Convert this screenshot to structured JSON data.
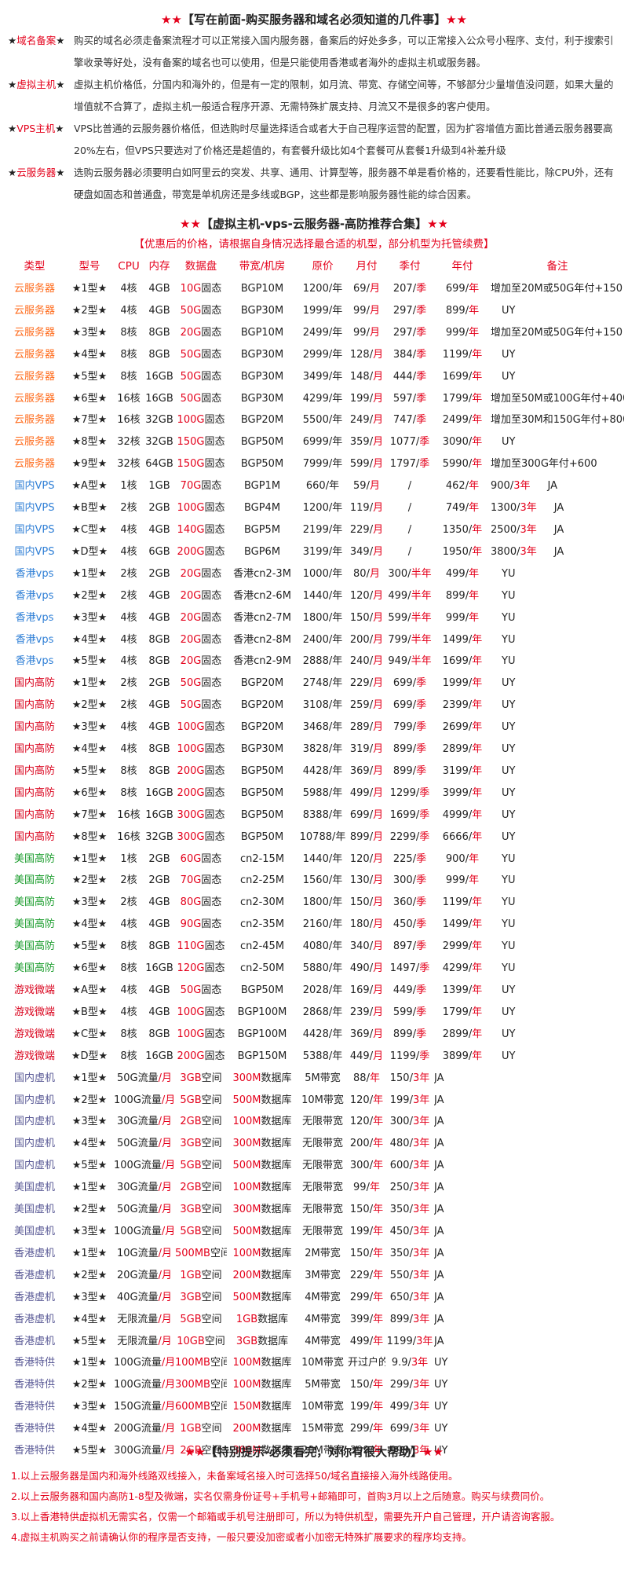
{
  "colors": {
    "accent_red": "#e4001b",
    "orange": "#ff6a1a",
    "blue": "#2f7fd6",
    "red": "#d9001b",
    "green": "#1a9c2c",
    "gray": "#5a5a96"
  },
  "section1": {
    "stars": "★★",
    "title": "【写在前面-购买服务器和域名必须知道的几件事】",
    "items": [
      {
        "tag": "域名备案",
        "text": "购买的域名必须走备案流程才可以正常接入国内服务器，备案后的好处多多，可以正常接入公众号小程序、支付，利于搜索引擎收录等好处，没有备案的域名也可以使用，但是只能使用香港或者海外的虚拟主机或服务器。"
      },
      {
        "tag": "虚拟主机",
        "text": "虚拟主机价格低，分国内和海外的，但是有一定的限制，如月流、带宽、存储空间等，不够部分少量增值没问题，如果大量的增值就不合算了，虚拟主机一般适合程序开源、无需特殊扩展支持、月流又不是很多的客户使用。"
      },
      {
        "tag": "VPS主机",
        "text": "VPS比普通的云服务器价格低，但选购时尽量选择适合或者大于自己程序运营的配置，因为扩容增值方面比普通云服务器要高20%左右，但VPS只要选对了价格还是超值的，有套餐升级比如4个套餐可从套餐1升级到4补差升级"
      },
      {
        "tag": "云服务器",
        "text": "选购云服务器必须要明白如阿里云的突发、共享、通用、计算型等，服务器不单是看价格的，还要看性能比，除CPU外，还有硬盘如固态和普通盘，带宽是单机房还是多线或BGP，这些都是影响服务器性能的综合因素。"
      }
    ]
  },
  "section2": {
    "stars": "★★",
    "title": "【虚拟主机-vps-云服务器-高防推荐合集】",
    "subtitle": "【优惠后的价格，请根据自身情况选择最合适的机型，部分机型为托管续费】",
    "headers": [
      "类型",
      "型号",
      "CPU",
      "内存",
      "数据盘",
      "带宽/机房",
      "原价",
      "月付",
      "季付",
      "年付",
      "备注"
    ],
    "rows_a": [
      {
        "cat": "云服务器",
        "model": "★1型★",
        "cpu": "4",
        "cpu_u": "核",
        "mem": "4GB",
        "disk": "10G",
        "disk_u": "固态",
        "bw": "BGP10M",
        "orig": "1200/年",
        "m": "69/",
        "q": "207/",
        "y": "699/",
        "note": "增加至20M或50G年付+150"
      },
      {
        "cat": "云服务器",
        "model": "★2型★",
        "cpu": "4",
        "cpu_u": "核",
        "mem": "4GB",
        "disk": "50G",
        "disk_u": "固态",
        "bw": "BGP30M",
        "orig": "1999/年",
        "m": "99/",
        "q": "297/",
        "y": "899/",
        "note": "UY"
      },
      {
        "cat": "云服务器",
        "model": "★3型★",
        "cpu": "8",
        "cpu_u": "核",
        "mem": "8GB",
        "disk": "20G",
        "disk_u": "固态",
        "bw": "BGP10M",
        "orig": "2499/年",
        "m": "99/",
        "q": "297/",
        "y": "999/",
        "note": "增加至20M或50G年付+150"
      },
      {
        "cat": "云服务器",
        "model": "★4型★",
        "cpu": "8",
        "cpu_u": "核",
        "mem": "8GB",
        "disk": "50G",
        "disk_u": "固态",
        "bw": "BGP30M",
        "orig": "2999/年",
        "m": "128/",
        "q": "384/",
        "y": "1199/",
        "note": "UY"
      },
      {
        "cat": "云服务器",
        "model": "★5型★",
        "cpu": "8",
        "cpu_u": "核",
        "mem": "16GB",
        "disk": "50G",
        "disk_u": "固态",
        "bw": "BGP30M",
        "orig": "3499/年",
        "m": "148/",
        "q": "444/",
        "y": "1699/",
        "note": "UY"
      },
      {
        "cat": "云服务器",
        "model": "★6型★",
        "cpu": "16",
        "cpu_u": "核",
        "mem": "16GB",
        "disk": "50G",
        "disk_u": "固态",
        "bw": "BGP30M",
        "orig": "4299/年",
        "m": "199/",
        "q": "597/",
        "y": "1799/",
        "note": "增加至50M或100G年付+400"
      },
      {
        "cat": "云服务器",
        "model": "★7型★",
        "cpu": "16",
        "cpu_u": "核",
        "mem": "32GB",
        "disk": "100G",
        "disk_u": "固态",
        "bw": "BGP20M",
        "orig": "5500/年",
        "m": "249/",
        "q": "747/",
        "y": "2499/",
        "note": "增加至30M和150G年付+800"
      },
      {
        "cat": "云服务器",
        "model": "★8型★",
        "cpu": "32",
        "cpu_u": "核",
        "mem": "32GB",
        "disk": "150G",
        "disk_u": "固态",
        "bw": "BGP50M",
        "orig": "6999/年",
        "m": "359/",
        "q": "1077/",
        "y": "3090/",
        "note": "UY"
      },
      {
        "cat": "云服务器",
        "model": "★9型★",
        "cpu": "32",
        "cpu_u": "核",
        "mem": "64GB",
        "disk": "150G",
        "disk_u": "固态",
        "bw": "BGP50M",
        "orig": "7999/年",
        "m": "599/",
        "q": "1797/",
        "y": "5990/",
        "note": "增加至300G年付+600"
      }
    ],
    "rows_b": [
      {
        "cat": "国内VPS",
        "model": "★A型★",
        "cpu": "1",
        "cpu_u": "核",
        "mem": "1GB",
        "disk": "70G",
        "disk_u": "固态",
        "bw": "BGP1M",
        "orig": "660/年",
        "m": "59/",
        "y": "462/",
        "ext": "900/",
        "note": "JA"
      },
      {
        "cat": "国内VPS",
        "model": "★B型★",
        "cpu": "2",
        "cpu_u": "核",
        "mem": "2GB",
        "disk": "100G",
        "disk_u": "固态",
        "bw": "BGP4M",
        "orig": "1200/年",
        "m": "119/",
        "y": "749/",
        "ext": "1300/",
        "note": "JA"
      },
      {
        "cat": "国内VPS",
        "model": "★C型★",
        "cpu": "4",
        "cpu_u": "核",
        "mem": "4GB",
        "disk": "140G",
        "disk_u": "固态",
        "bw": "BGP5M",
        "orig": "2199/年",
        "m": "229/",
        "y": "1350/",
        "ext": "2500/",
        "note": "JA"
      },
      {
        "cat": "国内VPS",
        "model": "★D型★",
        "cpu": "4",
        "cpu_u": "核",
        "mem": "6GB",
        "disk": "200G",
        "disk_u": "固态",
        "bw": "BGP6M",
        "orig": "3199/年",
        "m": "349/",
        "y": "1950/",
        "ext": "3800/",
        "note": "JA"
      }
    ],
    "rows_c": [
      {
        "cat": "香港vps",
        "model": "★1型★",
        "cpu": "2",
        "cpu_u": "核",
        "mem": "2GB",
        "disk": "20G",
        "disk_u": "固态",
        "bw": "香港cn2-3M",
        "orig": "1000/年",
        "m": "80/",
        "q": "300/",
        "y": "499/",
        "note": "YU"
      },
      {
        "cat": "香港vps",
        "model": "★2型★",
        "cpu": "2",
        "cpu_u": "核",
        "mem": "4GB",
        "disk": "20G",
        "disk_u": "固态",
        "bw": "香港cn2-6M",
        "orig": "1440/年",
        "m": "120/",
        "q": "499/",
        "y": "899/",
        "note": "YU"
      },
      {
        "cat": "香港vps",
        "model": "★3型★",
        "cpu": "4",
        "cpu_u": "核",
        "mem": "4GB",
        "disk": "20G",
        "disk_u": "固态",
        "bw": "香港cn2-7M",
        "orig": "1800/年",
        "m": "150/",
        "q": "599/",
        "y": "999/",
        "note": "YU"
      },
      {
        "cat": "香港vps",
        "model": "★4型★",
        "cpu": "4",
        "cpu_u": "核",
        "mem": "8GB",
        "disk": "20G",
        "disk_u": "固态",
        "bw": "香港cn2-8M",
        "orig": "2400/年",
        "m": "200/",
        "q": "799/",
        "y": "1499/",
        "note": "YU"
      },
      {
        "cat": "香港vps",
        "model": "★5型★",
        "cpu": "4",
        "cpu_u": "核",
        "mem": "8GB",
        "disk": "20G",
        "disk_u": "固态",
        "bw": "香港cn2-9M",
        "orig": "2888/年",
        "m": "240/",
        "q": "949/",
        "y": "1699/",
        "note": "YU"
      }
    ],
    "rows_d": [
      {
        "cat": "国内高防",
        "model": "★1型★",
        "cpu": "2",
        "cpu_u": "核",
        "mem": "2GB",
        "disk": "50G",
        "disk_u": "固态",
        "bw": "BGP20M",
        "orig": "2748/年",
        "m": "229/",
        "q": "699/",
        "y": "1999/",
        "note": "UY"
      },
      {
        "cat": "国内高防",
        "model": "★2型★",
        "cpu": "2",
        "cpu_u": "核",
        "mem": "4GB",
        "disk": "50G",
        "disk_u": "固态",
        "bw": "BGP20M",
        "orig": "3108/年",
        "m": "259/",
        "q": "699/",
        "y": "2399/",
        "note": "UY"
      },
      {
        "cat": "国内高防",
        "model": "★3型★",
        "cpu": "4",
        "cpu_u": "核",
        "mem": "4GB",
        "disk": "100G",
        "disk_u": "固态",
        "bw": "BGP20M",
        "orig": "3468/年",
        "m": "289/",
        "q": "799/",
        "y": "2699/",
        "note": "UY"
      },
      {
        "cat": "国内高防",
        "model": "★4型★",
        "cpu": "4",
        "cpu_u": "核",
        "mem": "8GB",
        "disk": "100G",
        "disk_u": "固态",
        "bw": "BGP30M",
        "orig": "3828/年",
        "m": "319/",
        "q": "899/",
        "y": "2899/",
        "note": "UY"
      },
      {
        "cat": "国内高防",
        "model": "★5型★",
        "cpu": "8",
        "cpu_u": "核",
        "mem": "8GB",
        "disk": "200G",
        "disk_u": "固态",
        "bw": "BGP50M",
        "orig": "4428/年",
        "m": "369/",
        "q": "899/",
        "y": "3199/",
        "note": "UY"
      },
      {
        "cat": "国内高防",
        "model": "★6型★",
        "cpu": "8",
        "cpu_u": "核",
        "mem": "16GB",
        "disk": "200G",
        "disk_u": "固态",
        "bw": "BGP50M",
        "orig": "5988/年",
        "m": "499/",
        "q": "1299/",
        "y": "3999/",
        "note": "UY"
      },
      {
        "cat": "国内高防",
        "model": "★7型★",
        "cpu": "16",
        "cpu_u": "核",
        "mem": "16GB",
        "disk": "300G",
        "disk_u": "固态",
        "bw": "BGP50M",
        "orig": "8388/年",
        "m": "699/",
        "q": "1699/",
        "y": "4999/",
        "note": "UY"
      },
      {
        "cat": "国内高防",
        "model": "★8型★",
        "cpu": "16",
        "cpu_u": "核",
        "mem": "32GB",
        "disk": "300G",
        "disk_u": "固态",
        "bw": "BGP50M",
        "orig": "10788/年",
        "m": "899/",
        "q": "2299/",
        "y": "6666/",
        "note": "UY"
      }
    ],
    "rows_e": [
      {
        "cat": "美国高防",
        "model": "★1型★",
        "cpu": "1",
        "cpu_u": "核",
        "mem": "2GB",
        "disk": "60G",
        "disk_u": "固态",
        "bw": "cn2-15M",
        "orig": "1440/年",
        "m": "120/",
        "q": "225/",
        "y": "900/",
        "note": "YU"
      },
      {
        "cat": "美国高防",
        "model": "★2型★",
        "cpu": "2",
        "cpu_u": "核",
        "mem": "2GB",
        "disk": "70G",
        "disk_u": "固态",
        "bw": "cn2-25M",
        "orig": "1560/年",
        "m": "130/",
        "q": "300/",
        "y": "999/",
        "note": "YU"
      },
      {
        "cat": "美国高防",
        "model": "★3型★",
        "cpu": "2",
        "cpu_u": "核",
        "mem": "4GB",
        "disk": "80G",
        "disk_u": "固态",
        "bw": "cn2-30M",
        "orig": "1800/年",
        "m": "150/",
        "q": "360/",
        "y": "1199/",
        "note": "YU"
      },
      {
        "cat": "美国高防",
        "model": "★4型★",
        "cpu": "4",
        "cpu_u": "核",
        "mem": "4GB",
        "disk": "90G",
        "disk_u": "固态",
        "bw": "cn2-35M",
        "orig": "2160/年",
        "m": "180/",
        "q": "450/",
        "y": "1499/",
        "note": "YU"
      },
      {
        "cat": "美国高防",
        "model": "★5型★",
        "cpu": "8",
        "cpu_u": "核",
        "mem": "8GB",
        "disk": "110G",
        "disk_u": "固态",
        "bw": "cn2-45M",
        "orig": "4080/年",
        "m": "340/",
        "q": "897/",
        "y": "2999/",
        "note": "YU"
      },
      {
        "cat": "美国高防",
        "model": "★6型★",
        "cpu": "8",
        "cpu_u": "核",
        "mem": "16GB",
        "disk": "120G",
        "disk_u": "固态",
        "bw": "cn2-50M",
        "orig": "5880/年",
        "m": "490/",
        "q": "1497/",
        "y": "4299/",
        "note": "YU"
      }
    ],
    "rows_f": [
      {
        "cat": "游戏微端",
        "model": "★A型★",
        "cpu": "4",
        "cpu_u": "核",
        "mem": "4GB",
        "disk": "50G",
        "disk_u": "固态",
        "bw": "BGP50M",
        "orig": "2028/年",
        "m": "169/",
        "q": "449/",
        "y": "1399/",
        "note": "UY"
      },
      {
        "cat": "游戏微端",
        "model": "★B型★",
        "cpu": "4",
        "cpu_u": "核",
        "mem": "4GB",
        "disk": "100G",
        "disk_u": "固态",
        "bw": "BGP100M",
        "orig": "2868/年",
        "m": "239/",
        "q": "599/",
        "y": "1799/",
        "note": "UY"
      },
      {
        "cat": "游戏微端",
        "model": "★C型★",
        "cpu": "8",
        "cpu_u": "核",
        "mem": "8GB",
        "disk": "100G",
        "disk_u": "固态",
        "bw": "BGP100M",
        "orig": "4428/年",
        "m": "369/",
        "q": "899/",
        "y": "2899/",
        "note": "UY"
      },
      {
        "cat": "游戏微端",
        "model": "★D型★",
        "cpu": "8",
        "cpu_u": "核",
        "mem": "16GB",
        "disk": "200G",
        "disk_u": "固态",
        "bw": "BGP150M",
        "orig": "5388/年",
        "m": "449/",
        "q": "1199/",
        "y": "3899/",
        "note": "UY"
      }
    ],
    "rows_g": [
      {
        "cat": "国内虚机",
        "model": "★1型★",
        "flow": "50G流量",
        "space": "3GB",
        "space_u": "空间",
        "db": "300M",
        "db_u": "数据库",
        "bw": "5M带宽",
        "y": "88/",
        "y3": "150/",
        "note": "JA"
      },
      {
        "cat": "国内虚机",
        "model": "★2型★",
        "flow": "100G流量",
        "space": "5GB",
        "space_u": "空间",
        "db": "500M",
        "db_u": "数据库",
        "bw": "10M带宽",
        "y": "120/",
        "y3": "199/",
        "note": "JA"
      },
      {
        "cat": "国内虚机",
        "model": "★3型★",
        "flow": "30G流量",
        "space": "2GB",
        "space_u": "空间",
        "db": "100M",
        "db_u": "数据库",
        "bw": "无限带宽",
        "y": "120/",
        "y3": "300/",
        "note": "JA"
      },
      {
        "cat": "国内虚机",
        "model": "★4型★",
        "flow": "50G流量",
        "space": "3GB",
        "space_u": "空间",
        "db": "300M",
        "db_u": "数据库",
        "bw": "无限带宽",
        "y": "200/",
        "y3": "480/",
        "note": "JA"
      },
      {
        "cat": "国内虚机",
        "model": "★5型★",
        "flow": "100G流量",
        "space": "5GB",
        "space_u": "空间",
        "db": "500M",
        "db_u": "数据库",
        "bw": "无限带宽",
        "y": "300/",
        "y3": "600/",
        "note": "JA"
      },
      {
        "cat": "美国虚机",
        "model": "★1型★",
        "flow": "30G流量",
        "space": "2GB",
        "space_u": "空间",
        "db": "100M",
        "db_u": "数据库",
        "bw": "无限带宽",
        "y": "99/",
        "y3": "250/",
        "note": "JA"
      },
      {
        "cat": "美国虚机",
        "model": "★2型★",
        "flow": "50G流量",
        "space": "3GB",
        "space_u": "空间",
        "db": "300M",
        "db_u": "数据库",
        "bw": "无限带宽",
        "y": "150/",
        "y3": "350/",
        "note": "JA"
      },
      {
        "cat": "美国虚机",
        "model": "★3型★",
        "flow": "100G流量",
        "space": "5GB",
        "space_u": "空间",
        "db": "500M",
        "db_u": "数据库",
        "bw": "无限带宽",
        "y": "199/",
        "y3": "450/",
        "note": "JA"
      },
      {
        "cat": "香港虚机",
        "model": "★1型★",
        "flow": "10G流量",
        "space": "500MB",
        "space_u": "空间",
        "db": "100M",
        "db_u": "数据库",
        "bw": "2M带宽",
        "y": "150/",
        "y3": "350/",
        "note": "JA"
      },
      {
        "cat": "香港虚机",
        "model": "★2型★",
        "flow": "20G流量",
        "space": "1GB",
        "space_u": "空间",
        "db": "200M",
        "db_u": "数据库",
        "bw": "3M带宽",
        "y": "229/",
        "y3": "550/",
        "note": "JA"
      },
      {
        "cat": "香港虚机",
        "model": "★3型★",
        "flow": "40G流量",
        "space": "3GB",
        "space_u": "空间",
        "db": "500M",
        "db_u": "数据库",
        "bw": "4M带宽",
        "y": "299/",
        "y3": "650/",
        "note": "JA"
      },
      {
        "cat": "香港虚机",
        "model": "★4型★",
        "flow": "无限流量",
        "space": "5GB",
        "space_u": "空间",
        "db": "1GB",
        "db_u": "数据库",
        "bw": "4M带宽",
        "y": "399/",
        "y3": "899/",
        "note": "JA"
      },
      {
        "cat": "香港虚机",
        "model": "★5型★",
        "flow": "无限流量",
        "space": "10GB",
        "space_u": "空间",
        "db": "3GB",
        "db_u": "数据库",
        "bw": "4M带宽",
        "y": "499/",
        "y3": "1199/",
        "note": "JA"
      },
      {
        "cat": "香港特供",
        "model": "★1型★",
        "flow": "100G流量",
        "space": "100MB",
        "space_u": "空间",
        "db": "100M",
        "db_u": "数据库",
        "bw": "10M带宽",
        "y": "开过户的",
        "y3": "9.9/",
        "note": "UY"
      },
      {
        "cat": "香港特供",
        "model": "★2型★",
        "flow": "100G流量",
        "space": "300MB",
        "space_u": "空间",
        "db": "100M",
        "db_u": "数据库",
        "bw": "5M带宽",
        "y": "150/",
        "y3": "299/",
        "note": "UY"
      },
      {
        "cat": "香港特供",
        "model": "★3型★",
        "flow": "150G流量",
        "space": "600MB",
        "space_u": "空间",
        "db": "150M",
        "db_u": "数据库",
        "bw": "10M带宽",
        "y": "199/",
        "y3": "499/",
        "note": "UY"
      },
      {
        "cat": "香港特供",
        "model": "★4型★",
        "flow": "200G流量",
        "space": "1GB",
        "space_u": "空间",
        "db": "200M",
        "db_u": "数据库",
        "bw": "15M带宽",
        "y": "299/",
        "y3": "699/",
        "note": "UY"
      },
      {
        "cat": "香港特供",
        "model": "★5型★",
        "flow": "300G流量",
        "space": "2GB",
        "space_u": "空间",
        "db": "300M",
        "db_u": "数据库",
        "bw": "20M带宽",
        "y": "399/",
        "y3": "999/",
        "note": "UY"
      }
    ]
  },
  "section3": {
    "stars": "★★",
    "title": "【特别提示-必须看完，对你有很大帮助】",
    "tips": [
      "1.以上云服务器是国内和海外线路双线接入，未备案域名接入时可选择50/域名直接接入海外线路使用。",
      "2.以上云服务器和国内高防1-8型及微端，实名仅需身份证号+手机号+邮箱即可，首购3月以上之后随意。购买与续费同价。",
      "3.以上香港特供虚拟机无需实名，仅需一个邮箱或手机号注册即可，所以为特供机型，需要先开户自己管理，开户请咨询客服。",
      "4.虚拟主机购买之前请确认你的程序是否支持，一般只要没加密或者小加密无特殊扩展要求的程序均支持。"
    ]
  },
  "units": {
    "year": "年",
    "month": "月",
    "quarter": "季",
    "half": "半年",
    "three_year": "3年",
    "per_month": "/月",
    "slash": "/"
  }
}
